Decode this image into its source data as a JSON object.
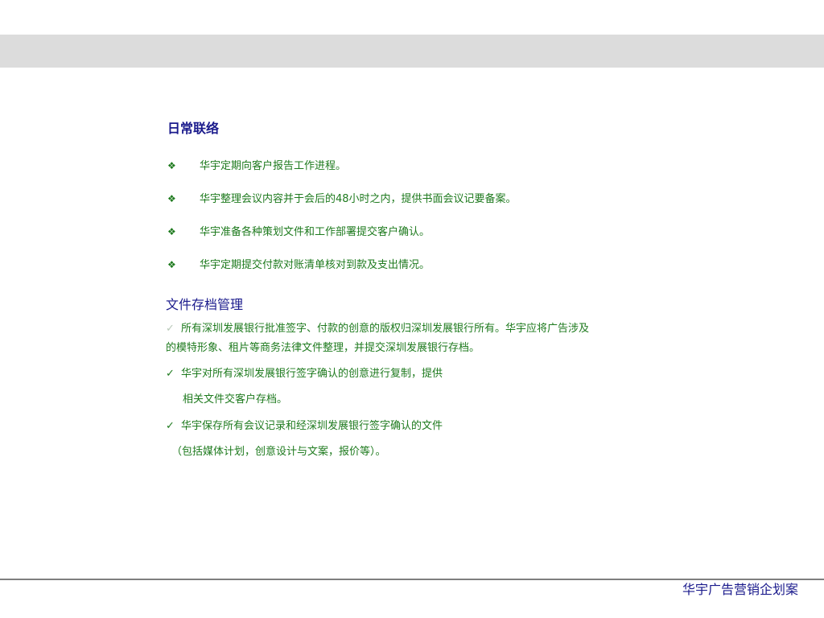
{
  "sections": {
    "daily": {
      "title": "日常联络",
      "bullet_glyph": "❖",
      "items": [
        "华宇定期向客户报告工作进程。",
        "华宇整理会议内容并于会后的48小时之内，提供书面会议记要备案。",
        "华宇准备各种策划文件和工作部署提交客户确认。",
        "华宇定期提交付款对账清单核对到款及支出情况。"
      ]
    },
    "archive": {
      "title": "文件存档管理",
      "check_glyph": "✓",
      "lines": [
        "所有深圳发展银行批准签字、付款的创意的版权归深圳发展银行所有。华宇应将广告涉及",
        "的模特形象、租片等商务法律文件整理，并提交深圳发展银行存档。",
        "华宇对所有深圳发展银行签字确认的创意进行复制，提供",
        "相关文件交客户存档。",
        "华宇保存所有会议记录和经深圳发展银行签字确认的文件",
        "（包括媒体计划，创意设计与文案，报价等）。"
      ]
    }
  },
  "footer": {
    "title": "华宇广告营销企划案"
  },
  "colors": {
    "heading": "#1a1a8c",
    "body_text": "#1e7a1e",
    "top_band": "#dcdcdc",
    "rule": "#7f7f7f"
  }
}
